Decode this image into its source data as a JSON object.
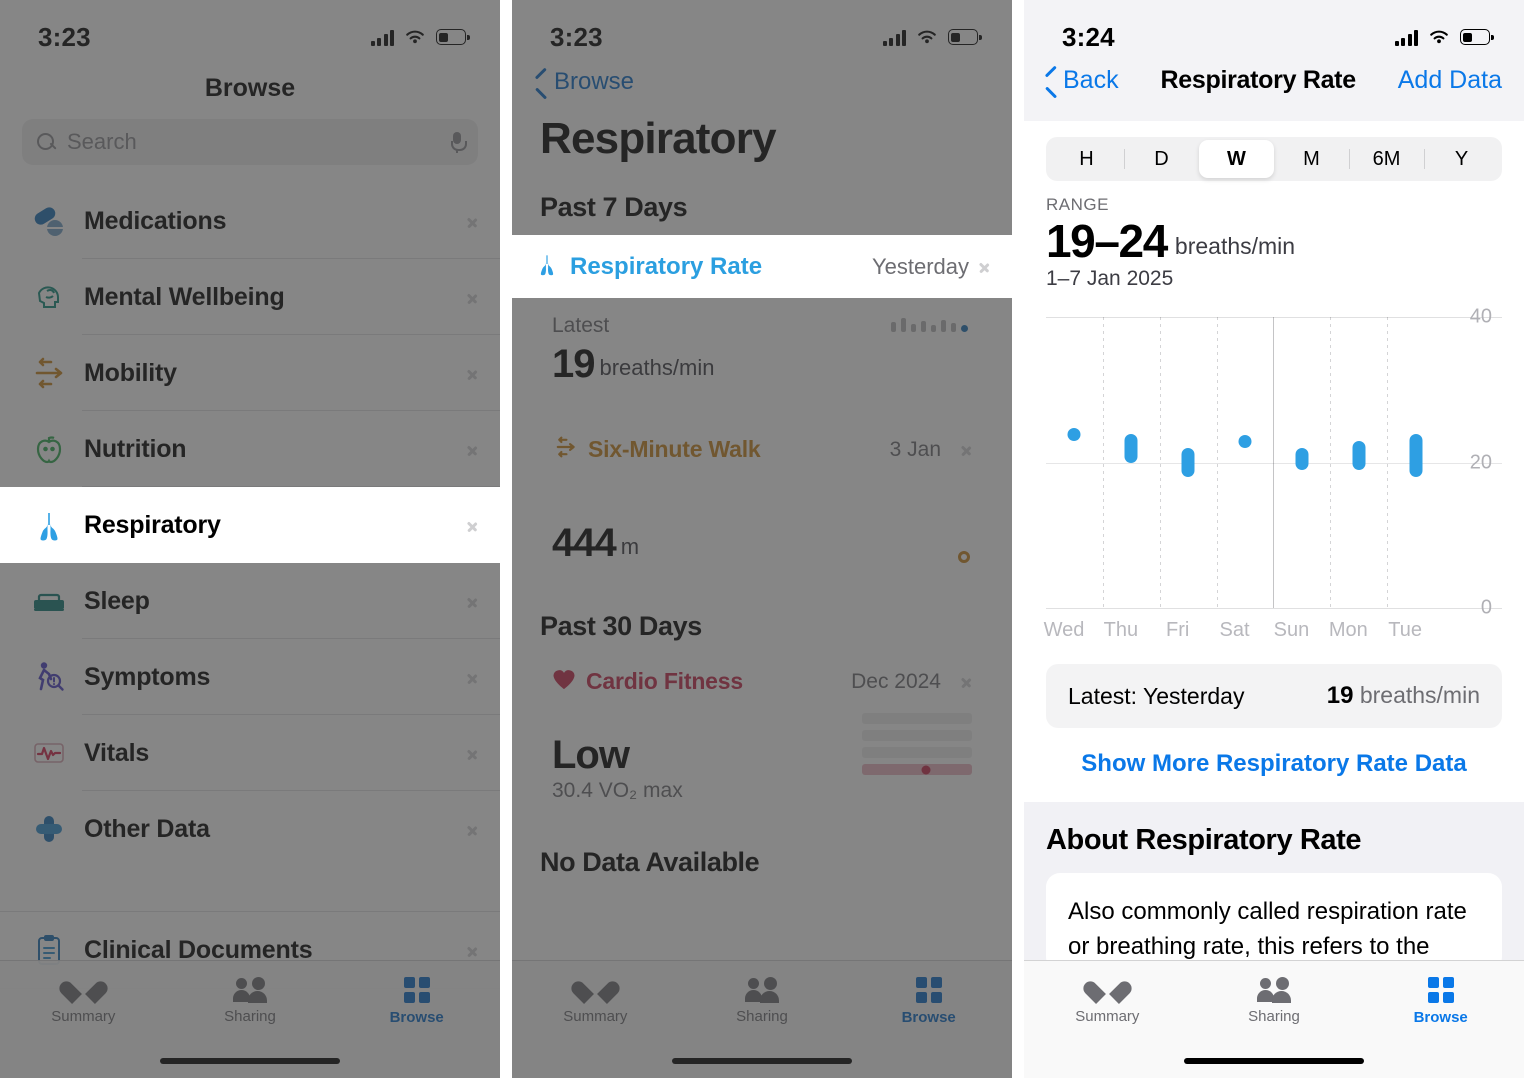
{
  "panel1": {
    "status": {
      "time": "3:23"
    },
    "title": "Browse",
    "search": {
      "placeholder": "Search",
      "search_icon": "search-icon",
      "mic_icon": "microphone-icon"
    },
    "items": [
      {
        "label": "Medications",
        "icon": "pills-icon",
        "color": "#1a6fb5"
      },
      {
        "label": "Mental Wellbeing",
        "icon": "brain-head-icon",
        "color": "#0f8a7a"
      },
      {
        "label": "Mobility",
        "icon": "mobility-arrows-icon",
        "color": "#c8851f"
      },
      {
        "label": "Nutrition",
        "icon": "apple-icon",
        "color": "#2ea84f"
      },
      {
        "label": "Respiratory",
        "icon": "lungs-icon",
        "color": "#2e9fe3"
      },
      {
        "label": "Sleep",
        "icon": "bed-icon",
        "color": "#0f7a74"
      },
      {
        "label": "Symptoms",
        "icon": "person-magnifier-icon",
        "color": "#4b3fc4"
      },
      {
        "label": "Vitals",
        "icon": "waveform-icon",
        "color": "#d1244b"
      },
      {
        "label": "Other Data",
        "icon": "plus-cross-icon",
        "color": "#1a6fb5"
      }
    ],
    "grouped": [
      {
        "label": "Clinical Documents",
        "icon": "clipboard-icon",
        "color": "#1a6fb5"
      }
    ],
    "selected_item": "Respiratory",
    "tabs": [
      {
        "label": "Summary",
        "icon": "heart-icon",
        "active": false
      },
      {
        "label": "Sharing",
        "icon": "people-icon",
        "active": false
      },
      {
        "label": "Browse",
        "icon": "grid-icon",
        "active": true
      }
    ]
  },
  "panel2": {
    "status": {
      "time": "3:23"
    },
    "back_label": "Browse",
    "heading": "Respiratory",
    "section_7": "Past 7 Days",
    "respiratory_rate": {
      "title": "Respiratory Rate",
      "date": "Yesterday",
      "icon": "lungs-icon",
      "latest_label": "Latest",
      "value": "19",
      "unit": "breaths/min"
    },
    "six_minute_walk": {
      "title": "Six-Minute Walk",
      "date": "3 Jan",
      "icon": "mobility-arrows-icon",
      "value": "444",
      "unit": "m"
    },
    "section_30": "Past 30 Days",
    "cardio_fitness": {
      "title": "Cardio Fitness",
      "date": "Dec 2024",
      "icon": "heart-icon",
      "value": "Low",
      "detail": "30.4 VO₂ max"
    },
    "no_data": "No Data Available",
    "tabs": [
      {
        "label": "Summary",
        "icon": "heart-icon",
        "active": false
      },
      {
        "label": "Sharing",
        "icon": "people-icon",
        "active": false
      },
      {
        "label": "Browse",
        "icon": "grid-icon",
        "active": true
      }
    ]
  },
  "panel3": {
    "status": {
      "time": "3:24"
    },
    "nav": {
      "back": "Back",
      "title": "Respiratory Rate",
      "action": "Add Data"
    },
    "segments": [
      {
        "label": "H",
        "selected": false
      },
      {
        "label": "D",
        "selected": false
      },
      {
        "label": "W",
        "selected": true
      },
      {
        "label": "M",
        "selected": false
      },
      {
        "label": "6M",
        "selected": false
      },
      {
        "label": "Y",
        "selected": false
      }
    ],
    "range_label": "RANGE",
    "range_value": "19–24",
    "range_unit": "breaths/min",
    "range_date": "1–7 Jan 2025",
    "latest": {
      "label": "Latest: Yesterday",
      "value": "19",
      "unit": "breaths/min"
    },
    "show_more": "Show More Respiratory Rate Data",
    "about_heading": "About Respiratory Rate",
    "about_text": "Also commonly called respiration rate or breathing rate, this refers to the",
    "tabs": [
      {
        "label": "Summary",
        "icon": "heart-icon",
        "active": false
      },
      {
        "label": "Sharing",
        "icon": "people-icon",
        "active": false
      },
      {
        "label": "Browse",
        "icon": "grid-icon",
        "active": true
      }
    ],
    "chart_data": {
      "type": "bar",
      "title": "Respiratory Rate",
      "subtitle": "1–7 Jan 2025",
      "xlabel": "",
      "ylabel": "breaths/min",
      "ylim": [
        0,
        40
      ],
      "yticks": [
        0,
        20,
        40
      ],
      "grid": true,
      "legend": null,
      "series_color": "#2e9fe3",
      "categories": [
        "Wed",
        "Thu",
        "Fri",
        "Sat",
        "Sun",
        "Mon",
        "Tue"
      ],
      "ranges": [
        {
          "day": "Wed",
          "min": 23,
          "max": 23
        },
        {
          "day": "Thu",
          "min": 20,
          "max": 24
        },
        {
          "day": "Fri",
          "min": 18,
          "max": 22
        },
        {
          "day": "Sat",
          "min": 22,
          "max": 22
        },
        {
          "day": "Sun",
          "min": 19,
          "max": 22
        },
        {
          "day": "Mon",
          "min": 19,
          "max": 23
        },
        {
          "day": "Tue",
          "min": 18,
          "max": 24
        }
      ]
    }
  }
}
